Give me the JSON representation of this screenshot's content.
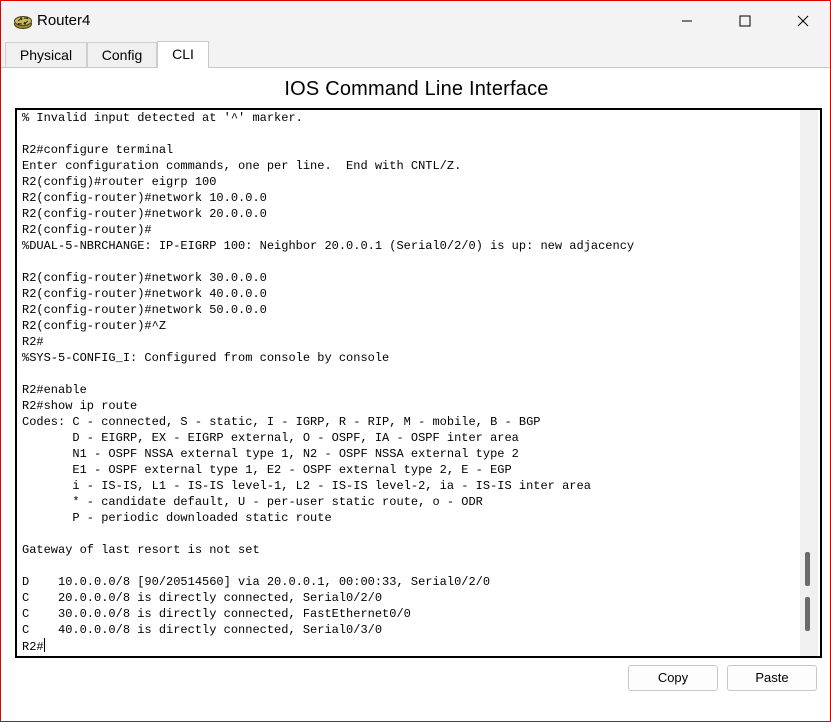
{
  "window": {
    "title": "Router4",
    "accent_color": "#e00000"
  },
  "tabs": [
    {
      "label": "Physical"
    },
    {
      "label": "Config"
    },
    {
      "label": "CLI",
      "selected": true
    }
  ],
  "main": {
    "heading": "IOS Command Line Interface"
  },
  "terminal": {
    "lines": [
      "% Invalid input detected at '^' marker.",
      "",
      "R2#configure terminal",
      "Enter configuration commands, one per line.  End with CNTL/Z.",
      "R2(config)#router eigrp 100",
      "R2(config-router)#network 10.0.0.0",
      "R2(config-router)#network 20.0.0.0",
      "R2(config-router)#",
      "%DUAL-5-NBRCHANGE: IP-EIGRP 100: Neighbor 20.0.0.1 (Serial0/2/0) is up: new adjacency",
      "",
      "R2(config-router)#network 30.0.0.0",
      "R2(config-router)#network 40.0.0.0",
      "R2(config-router)#network 50.0.0.0",
      "R2(config-router)#^Z",
      "R2#",
      "%SYS-5-CONFIG_I: Configured from console by console",
      "",
      "R2#enable",
      "R2#show ip route",
      "Codes: C - connected, S - static, I - IGRP, R - RIP, M - mobile, B - BGP",
      "       D - EIGRP, EX - EIGRP external, O - OSPF, IA - OSPF inter area",
      "       N1 - OSPF NSSA external type 1, N2 - OSPF NSSA external type 2",
      "       E1 - OSPF external type 1, E2 - OSPF external type 2, E - EGP",
      "       i - IS-IS, L1 - IS-IS level-1, L2 - IS-IS level-2, ia - IS-IS inter area",
      "       * - candidate default, U - per-user static route, o - ODR",
      "       P - periodic downloaded static route",
      "",
      "Gateway of last resort is not set",
      "",
      "D    10.0.0.0/8 [90/20514560] via 20.0.0.1, 00:00:33, Serial0/2/0",
      "C    20.0.0.0/8 is directly connected, Serial0/2/0",
      "C    30.0.0.0/8 is directly connected, FastEthernet0/0",
      "C    40.0.0.0/8 is directly connected, Serial0/3/0"
    ],
    "prompt": "R2#"
  },
  "actions": {
    "copy_label": "Copy",
    "paste_label": "Paste"
  }
}
